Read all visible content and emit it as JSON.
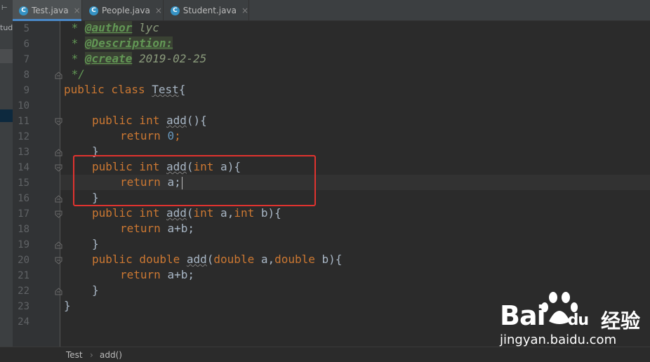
{
  "left_panel": {
    "label": "tud"
  },
  "tabs": [
    {
      "label": "Test.java",
      "icon": "C",
      "active": true
    },
    {
      "label": "People.java",
      "icon": "C",
      "active": false
    },
    {
      "label": "Student.java",
      "icon": "C",
      "active": false
    }
  ],
  "line_numbers": [
    "5",
    "6",
    "7",
    "8",
    "9",
    "10",
    "11",
    "12",
    "13",
    "14",
    "15",
    "16",
    "17",
    "18",
    "19",
    "20",
    "21",
    "22",
    "23",
    "24"
  ],
  "code": {
    "l5": {
      "star": " * ",
      "tag": "@author",
      "val": " lyc"
    },
    "l6": {
      "star": " * ",
      "tag": "@Description:"
    },
    "l7": {
      "star": " * ",
      "tag": "@create",
      "val": " 2019-02-25"
    },
    "l8": {
      "text": " */"
    },
    "l9": {
      "kw": "public class ",
      "name": "Test",
      "rest": "{"
    },
    "l11": {
      "kw": "public int ",
      "name": "add",
      "rest": "(){"
    },
    "l12": {
      "kw": "return ",
      "num": "0",
      "rest": ";"
    },
    "l13": {
      "text": "}"
    },
    "l14": {
      "kw": "public int ",
      "name": "add",
      "open": "(",
      "kw2": "int",
      "rest": " a){"
    },
    "l15": {
      "kw": "return ",
      "rest": "a;"
    },
    "l16": {
      "text": "}"
    },
    "l17": {
      "kw": "public int ",
      "name": "add",
      "open": "(",
      "kw2": "int",
      "mid": " a,",
      "kw3": "int",
      "rest": " b){"
    },
    "l18": {
      "kw": "return ",
      "rest": "a+b;"
    },
    "l19": {
      "text": "}"
    },
    "l20": {
      "kw": "public double ",
      "name": "add",
      "open": "(",
      "kw2": "double",
      "mid": " a,",
      "kw3": "double",
      "rest": " b){"
    },
    "l21": {
      "kw": "return ",
      "rest": "a+b;"
    },
    "l22": {
      "text": "}"
    },
    "l23": {
      "text": "}"
    }
  },
  "breadcrumb": {
    "class": "Test",
    "sep": "›",
    "method": "add()"
  },
  "watermark": {
    "brand": "Bai",
    "brand2": "du",
    "cn": "经验",
    "url": "jingyan.baidu.com"
  },
  "colors": {
    "keyword": "#cc7832",
    "number": "#6897bb",
    "comment": "#629755",
    "highlight_box": "#e0332f",
    "tab_underline": "#4a88c7"
  }
}
